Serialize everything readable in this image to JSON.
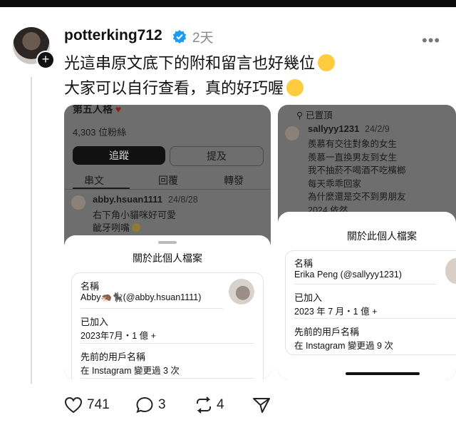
{
  "post": {
    "username": "potterking712",
    "timestamp": "2天",
    "line1": "光這串原文底下的附和留言也好幾位",
    "line2": "大家可以自行查看，真的好巧喔"
  },
  "shot1": {
    "name_partial": "第五人格",
    "followers": "4,303 位粉絲",
    "follow_label": "追蹤",
    "mention_label": "提及",
    "tabs": [
      "串文",
      "回覆",
      "轉發"
    ],
    "reply_user": "abby.hsuan1111",
    "reply_date": "24/8/28",
    "reply_line1": "右下角小貓咪好可愛",
    "reply_line2": "齜牙咧嘴",
    "sheet_title": "關於此個人檔案",
    "name_label": "名稱",
    "name_value": "Abby🦔🐈‍⬛(@abby.hsuan1111)",
    "joined_label": "已加入",
    "joined_value": "2023年7月・1 億 +",
    "prev_label": "先前的用戶名稱",
    "prev_value": "在 Instagram 變更過 3 次"
  },
  "shot2": {
    "pinned": "已置頂",
    "user": "sallyyy1231",
    "date": "24/2/9",
    "lines": [
      "羨慕有交往對象的女生",
      "羨慕一直換男友到女生",
      "我不抽菸不喝酒不吃檳榔",
      "每天乖乖回家",
      "為什麼還是交不到男朋友",
      "2024 依然"
    ],
    "sheet_title": "關於此個人檔案",
    "name_label": "名稱",
    "name_value": "Erika Peng (@sallyyy1231)",
    "joined_label": "已加入",
    "joined_value": "2023 年 7 月・1 億 +",
    "prev_label": "先前的用戶名稱",
    "prev_value": "在 Instagram 變更過 9 次"
  },
  "actions": {
    "likes": "741",
    "comments": "3",
    "reposts": "4"
  }
}
